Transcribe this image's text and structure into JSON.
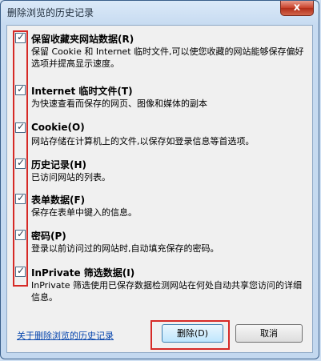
{
  "window": {
    "title": "删除浏览的历史记录",
    "close_label": "x"
  },
  "options": [
    {
      "label": "保留收藏夹网站数据(R)",
      "description": "保留 Cookie 和 Internet 临时文件,可以使您收藏的网站能够保存偏好选项并提高显示速度。",
      "checked": true
    },
    {
      "label": "Internet 临时文件(T)",
      "description": "为快速查看而保存的网页、图像和媒体的副本",
      "checked": true
    },
    {
      "label": "Cookie(O)",
      "description": "网站存储在计算机上的文件,以保存如登录信息等首选项。",
      "checked": true
    },
    {
      "label": "历史记录(H)",
      "description": "已访问网站的列表。",
      "checked": true
    },
    {
      "label": "表单数据(F)",
      "description": "保存在表单中键入的信息。",
      "checked": true
    },
    {
      "label": "密码(P)",
      "description": "登录以前访问过的网站时,自动填充保存的密码。",
      "checked": true
    },
    {
      "label": "InPrivate 筛选数据(I)",
      "description": "InPrivate 筛选使用已保存数据检测网站在何处自动共享您访问的详细信息。",
      "checked": true
    }
  ],
  "footer": {
    "help_link": "关于删除浏览的历史记录",
    "delete_label": "删除(D)",
    "cancel_label": "取消"
  },
  "colors": {
    "highlight_box": "#d62a26",
    "link": "#0645ad"
  }
}
